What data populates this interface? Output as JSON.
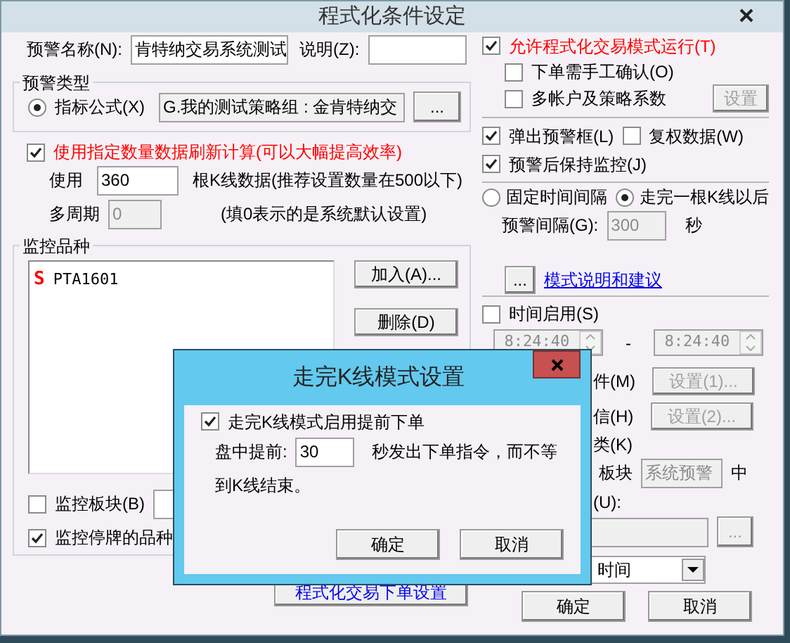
{
  "window": {
    "title": "程式化条件设定"
  },
  "name": {
    "label": "预警名称(N):",
    "value": "肯特纳交易系统测试"
  },
  "description": {
    "label": "说明(Z):"
  },
  "alert_type": {
    "title": "预警类型",
    "option": {
      "label": "指标公式(X)",
      "selected": true
    },
    "formula": "G.我的测试策略组 : 金肯特纳交",
    "browse": "..."
  },
  "refresh": {
    "label": "使用指定数量数据刷新计算(可以大幅提高效率)",
    "checked": true
  },
  "bars": {
    "label": "使用",
    "value": "360",
    "hint": "根K线数据(推荐设置数量在500以下)"
  },
  "multi_period": {
    "label": "多周期",
    "value": "0",
    "hint": "(填0表示的是系统默认设置)"
  },
  "monitor": {
    "title": "监控品种",
    "items": [
      {
        "mark": "S",
        "code": "PTA1601"
      }
    ],
    "add": "加入(A)...",
    "remove": "删除(D)"
  },
  "sector": {
    "label": "监控板块(B)",
    "checked": false
  },
  "suspended": {
    "label": "监控停牌的品种",
    "checked": true
  },
  "order_settings": "程式化交易下单设置",
  "allow_trading": {
    "label": "允许程式化交易模式运行(T)",
    "checked": true
  },
  "manual_confirm": {
    "label": "下单需手工确认(O)",
    "checked": false
  },
  "multi_account": {
    "label": "多帐户及策略系数",
    "checked": false,
    "button": "设置"
  },
  "popup": {
    "label": "弹出预警框(L)",
    "checked": true
  },
  "adjusted": {
    "label": "复权数据(W)",
    "checked": false
  },
  "keep_monitoring": {
    "label": "预警后保持监控(J)",
    "checked": true
  },
  "interval_modes": [
    {
      "label": "固定时间间隔",
      "selected": false
    },
    {
      "label": "走完一根K线以后",
      "selected": true
    }
  ],
  "interval": {
    "label": "预警间隔(G):",
    "value": "300",
    "unit": "秒"
  },
  "mode_help": {
    "button": "...",
    "link": "模式说明和建议"
  },
  "time_enabled": {
    "label": "时间启用(S)",
    "checked": false
  },
  "time_range": {
    "start": "8:24:40",
    "separator": "-",
    "end": "8:24:40"
  },
  "mail": {
    "label": "件(M)",
    "button": "设置(1)..."
  },
  "sms": {
    "label": "信(H)",
    "button": "设置(2)..."
  },
  "category": {
    "label": "类(K)"
  },
  "board": {
    "label": "板块",
    "value": "系统预警",
    "suffix": "中"
  },
  "u_field": {
    "label": "(U):",
    "button": "..."
  },
  "time_select": {
    "value": "时间"
  },
  "buttons": [
    "确定",
    "取消"
  ],
  "modal": {
    "title": "走完K线模式设置",
    "early": {
      "label": "走完K线模式启用提前下单",
      "checked": true
    },
    "advance_label": "盘中提前:",
    "advance_value": "30",
    "advance_text": "秒发出下单指令，而不等",
    "advance_text_2": "到K线结束。",
    "buttons": [
      "确定",
      "取消"
    ]
  }
}
